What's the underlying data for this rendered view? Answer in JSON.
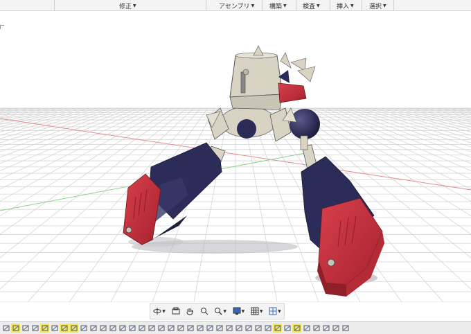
{
  "menubar": {
    "items": [
      {
        "label": "修正"
      },
      {
        "label": "アセンブリ"
      },
      {
        "label": "構築"
      },
      {
        "label": "検査"
      },
      {
        "label": "挿入"
      },
      {
        "label": "選択"
      }
    ]
  },
  "nav_bar": {
    "tools": [
      {
        "icon": "orbit-icon",
        "dropdown": true
      },
      {
        "icon": "look-at-icon",
        "dropdown": false
      },
      {
        "icon": "pan-hand-icon",
        "dropdown": false
      },
      {
        "icon": "zoom-window-icon",
        "dropdown": false
      },
      {
        "icon": "zoom-icon",
        "dropdown": true
      },
      {
        "icon": "display-settings-icon",
        "dropdown": true
      },
      {
        "icon": "grid-settings-icon",
        "dropdown": true
      },
      {
        "icon": "viewports-icon",
        "dropdown": true
      }
    ]
  },
  "timeline": {
    "highlight_color": "#f2e85e",
    "items": [
      "sketch",
      "sketch-hl",
      "sketch",
      "sketch",
      "sketch-hl",
      "sketch",
      "sketch-hl",
      "sketch-hl",
      "sketch",
      "sketch",
      "sketch",
      "sketch",
      "sketch",
      "sketch",
      "sketch",
      "sketch",
      "sketch",
      "sketch",
      "sketch",
      "sketch",
      "sketch",
      "sketch",
      "sketch",
      "sketch",
      "sketch",
      "sketch",
      "sketch",
      "sketch",
      "sketch-hl",
      "sketch",
      "sketch-hl",
      "sketch",
      "sketch",
      "sketch",
      "sketch",
      "sketch"
    ]
  },
  "colors": {
    "navy": "#2c2c58",
    "red": "#c8323f",
    "beige": "#d8d3c2",
    "grid": "#d3d3d3"
  }
}
